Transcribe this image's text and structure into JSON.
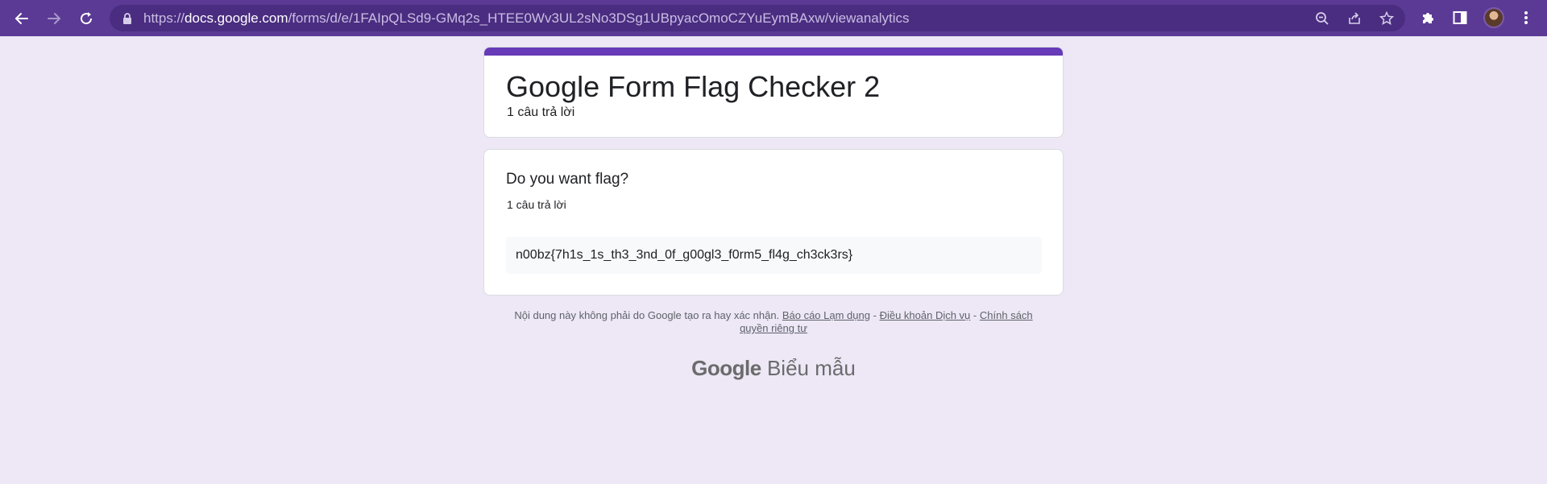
{
  "browser": {
    "url_prefix": "https://",
    "url_host": "docs.google.com",
    "url_path": "/forms/d/e/1FAIpQLSd9-GMq2s_HTEE0Wv3UL2sNo3DSg1UBpyacOmoCZYuEymBAxw/viewanalytics",
    "toolbar_color": "#5b3a96"
  },
  "form": {
    "title": "Google Form Flag Checker 2",
    "response_count": "1 câu trả lời",
    "accent_color": "#673ab7"
  },
  "question": {
    "title": "Do you want flag?",
    "response_count": "1 câu trả lời",
    "answer": "n00bz{7h1s_1s_th3_3nd_0f_g00gl3_f0rm5_fl4g_ch3ck3rs}"
  },
  "footer": {
    "disclaimer_text": "Nội dung này không phải do Google tạo ra hay xác nhận.",
    "report_link": "Báo cáo Lạm dụng",
    "separator": "-",
    "terms_link": "Điều khoản Dịch vụ",
    "privacy_link": "Chính sách quyền riêng tư",
    "brand_google": "Google",
    "brand_product": "Biểu mẫu"
  }
}
